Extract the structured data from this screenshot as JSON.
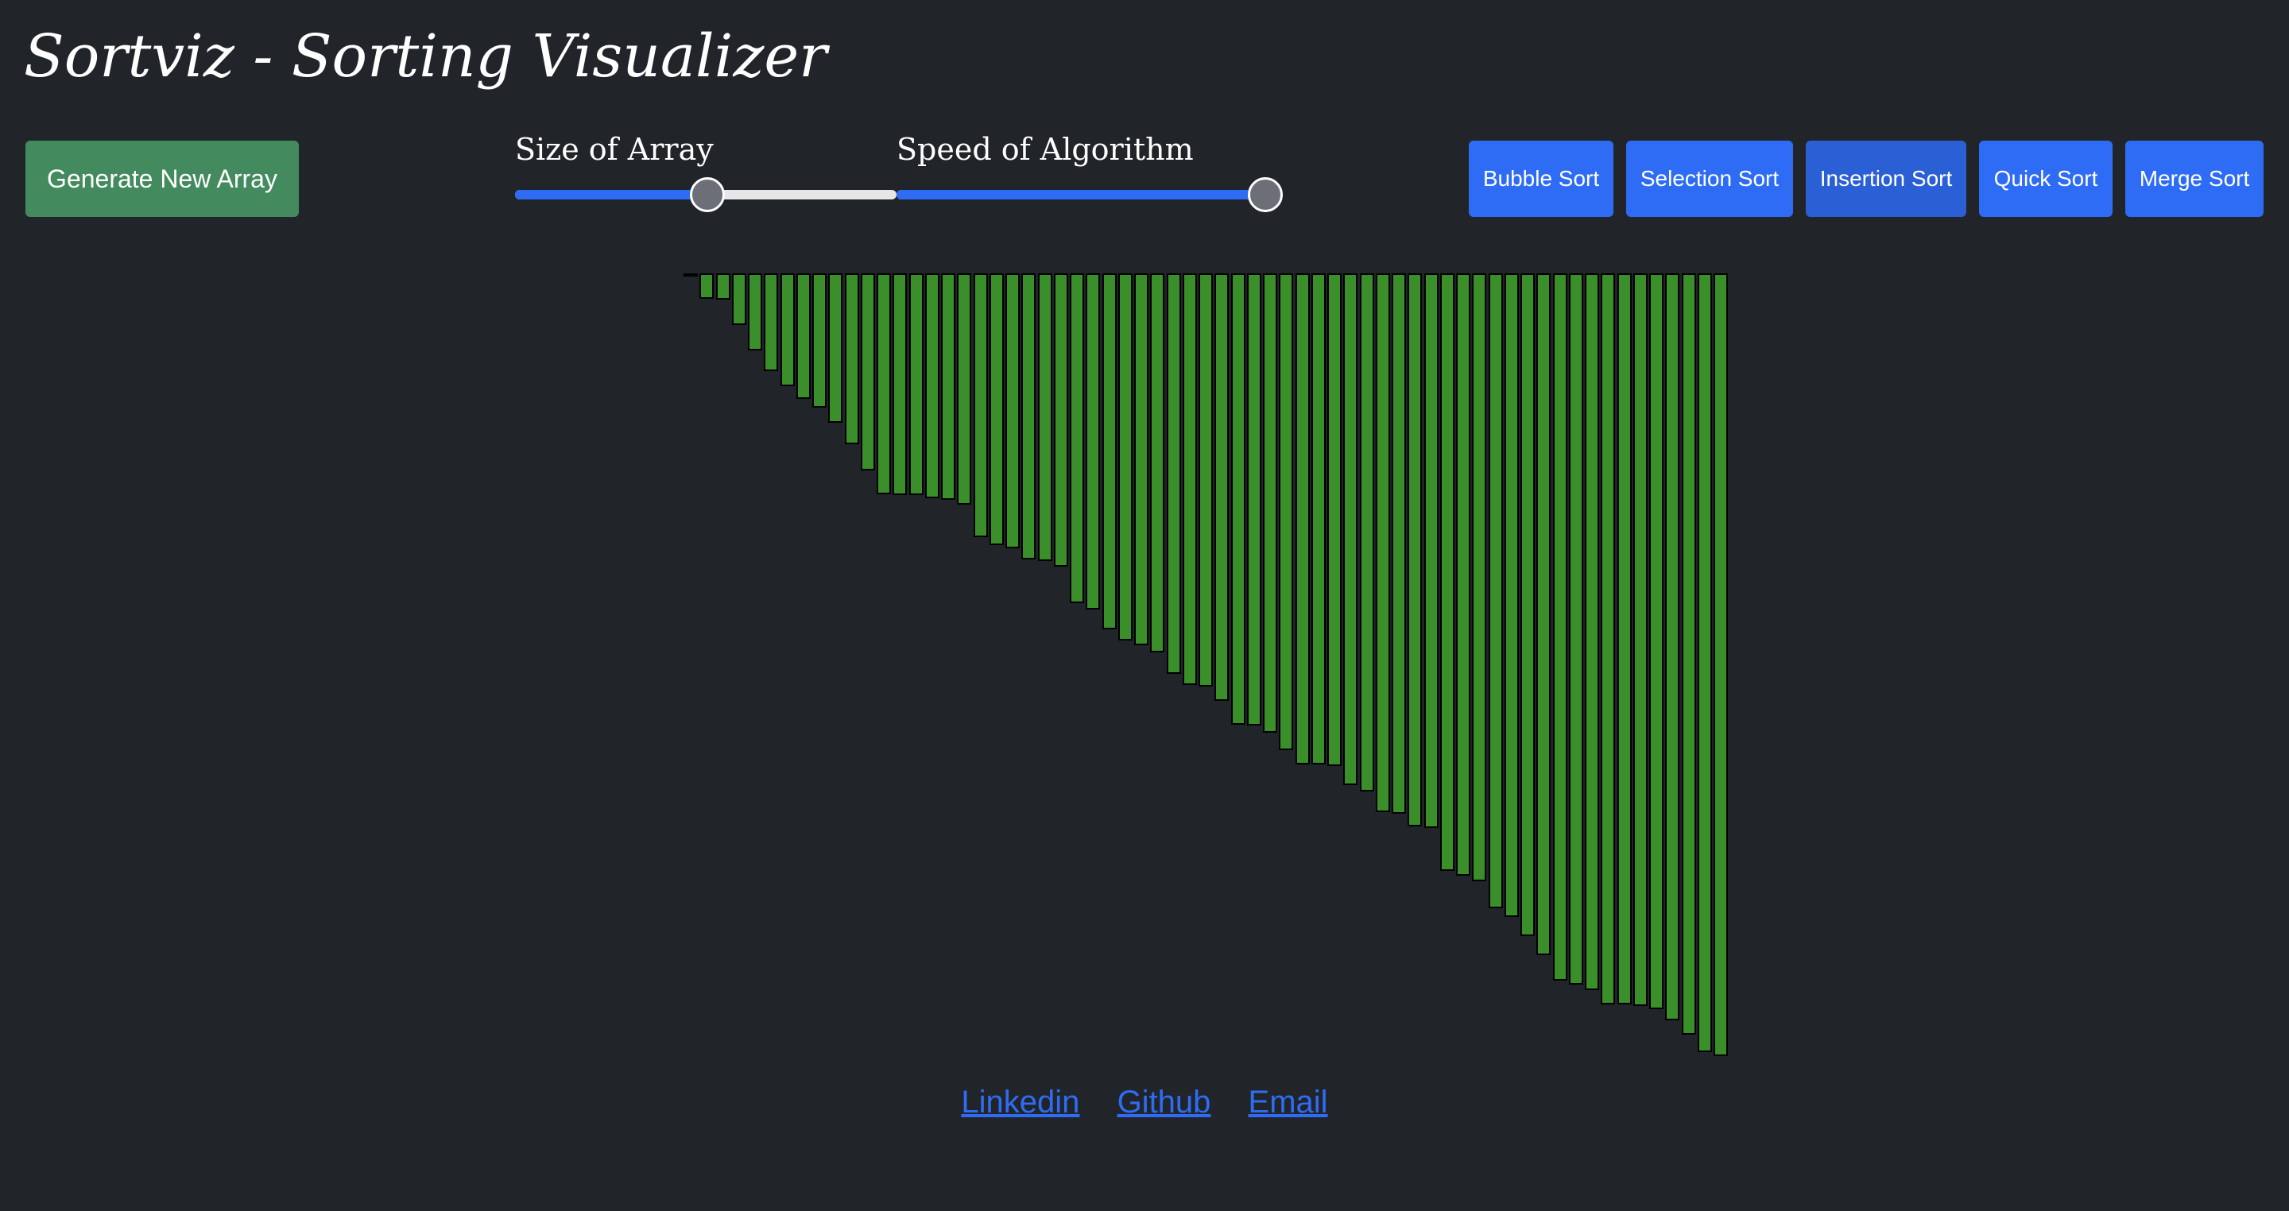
{
  "header": {
    "title": "Sortviz - Sorting Visualizer"
  },
  "controls": {
    "generate_label": "Generate New Array",
    "size_slider": {
      "label": "Size of Array",
      "value": 0.5
    },
    "speed_slider": {
      "label": "Speed of Algorithm",
      "value": 1.0
    },
    "sort_buttons": [
      {
        "label": "Bubble Sort",
        "active": false
      },
      {
        "label": "Selection Sort",
        "active": false
      },
      {
        "label": "Insertion Sort",
        "active": true
      },
      {
        "label": "Quick Sort",
        "active": false
      },
      {
        "label": "Merge Sort",
        "active": false
      }
    ]
  },
  "colors": {
    "background": "#212529",
    "bar": "#3a8f2a",
    "bar_border": "#000000",
    "generate_button": "#438a5e",
    "sort_button": "#2f6cf5",
    "sort_button_active": "#2b5fd6",
    "link": "#2f6cf5"
  },
  "array": {
    "values": [
      1,
      32,
      33,
      65,
      97,
      123,
      142,
      158,
      169,
      188,
      215,
      248,
      278,
      279,
      279,
      283,
      285,
      291,
      332,
      342,
      346,
      360,
      362,
      369,
      415,
      423,
      448,
      462,
      468,
      477,
      504,
      518,
      520,
      538,
      568,
      569,
      578,
      600,
      618,
      618,
      620,
      644,
      652,
      678,
      680,
      696,
      698,
      752,
      758,
      765,
      799,
      810,
      834,
      858,
      890,
      895,
      902,
      920,
      920,
      922,
      926,
      940,
      958,
      980,
      985
    ]
  },
  "footer": {
    "links": [
      "Linkedin",
      "Github",
      "Email"
    ]
  }
}
